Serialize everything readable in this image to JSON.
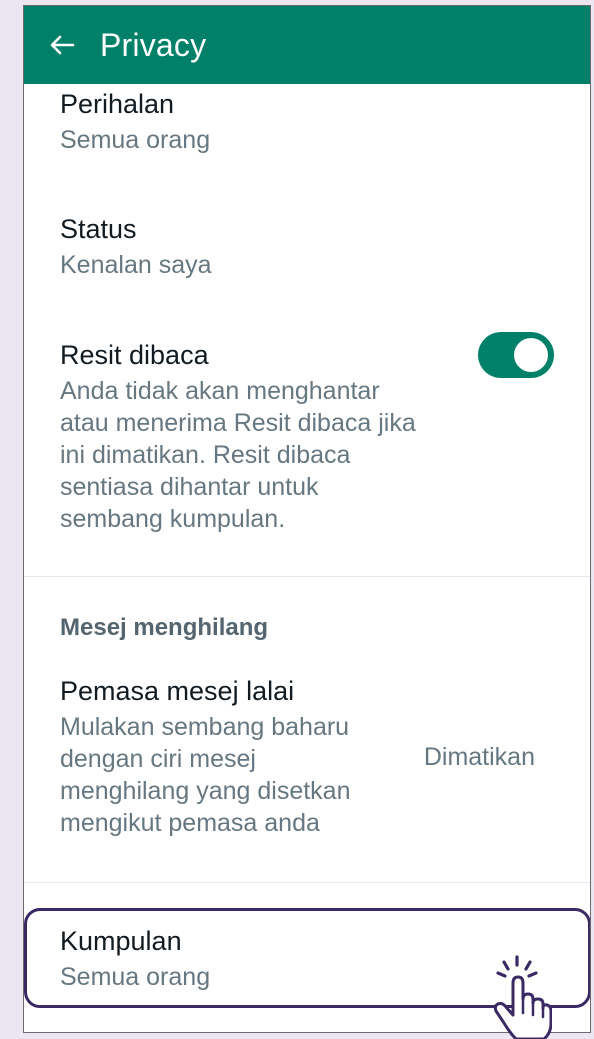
{
  "appbar": {
    "title": "Privacy",
    "back_icon": "arrow-left-icon"
  },
  "items": {
    "about": {
      "label": "Perihalan",
      "value": "Semua orang"
    },
    "status": {
      "label": "Status",
      "value": "Kenalan saya"
    },
    "read_receipts": {
      "label": "Resit dibaca",
      "description": "Anda tidak akan menghantar atau menerima Resit dibaca jika ini dimatikan. Resit dibaca sentiasa dihantar untuk sembang kumpulan.",
      "enabled": true
    },
    "disappearing_header": "Mesej menghilang",
    "default_timer": {
      "label": "Pemasa mesej lalai",
      "description": "Mulakan sembang baharu dengan ciri mesej menghilang yang disetkan mengikut pemasa anda",
      "value": "Dimatikan"
    },
    "groups": {
      "label": "Kumpulan",
      "value": "Semua orang"
    }
  },
  "colors": {
    "accent": "#008069",
    "highlight": "#3a2a63"
  }
}
